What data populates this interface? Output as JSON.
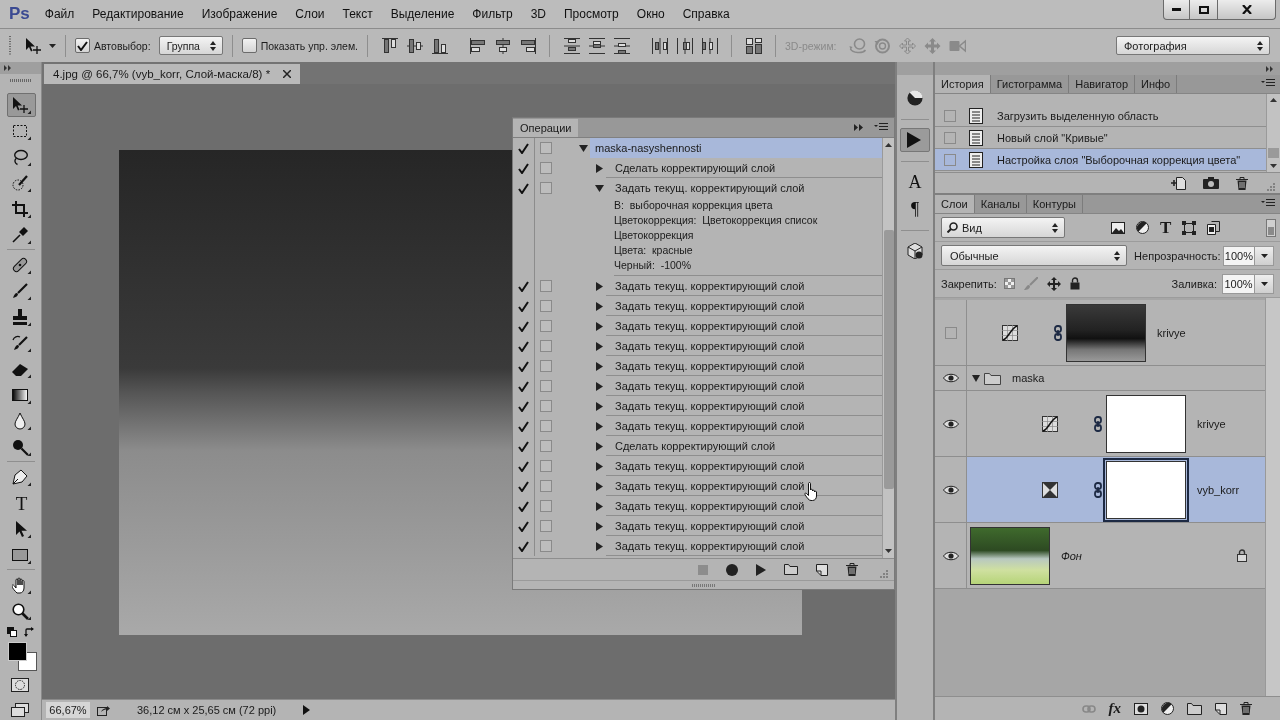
{
  "app": {
    "logo": "Ps"
  },
  "menu": [
    "Файл",
    "Редактирование",
    "Изображение",
    "Слои",
    "Текст",
    "Выделение",
    "Фильтр",
    "3D",
    "Просмотр",
    "Окно",
    "Справка"
  ],
  "options_bar": {
    "auto_select": {
      "label": "Автовыбор:",
      "checked": true
    },
    "auto_select_target": "Группа",
    "show_transform": {
      "label": "Показать упр. элем.",
      "checked": false
    },
    "mode_3d": {
      "label": "3D-режим:",
      "disabled": true
    },
    "workspace": "Фотография"
  },
  "tool_groups": [
    [
      {
        "kind": "move",
        "selected": true
      },
      {
        "kind": "marquee",
        "selected": false
      },
      {
        "kind": "lasso",
        "selected": false
      },
      {
        "kind": "quickselect",
        "selected": false
      },
      {
        "kind": "crop",
        "selected": false
      },
      {
        "kind": "eyedropper",
        "selected": false
      }
    ],
    [
      {
        "kind": "healing",
        "selected": false
      },
      {
        "kind": "brush",
        "selected": false
      },
      {
        "kind": "stamp",
        "selected": false
      },
      {
        "kind": "historybrush",
        "selected": false
      },
      {
        "kind": "eraser",
        "selected": false
      },
      {
        "kind": "gradient",
        "selected": false
      },
      {
        "kind": "blur",
        "selected": false
      },
      {
        "kind": "dodge",
        "selected": false
      }
    ],
    [
      {
        "kind": "pen",
        "selected": false
      },
      {
        "kind": "type",
        "glyph": "T",
        "selected": false
      },
      {
        "kind": "pathselect",
        "selected": false
      },
      {
        "kind": "shape",
        "selected": false
      }
    ],
    [
      {
        "kind": "hand",
        "selected": false
      },
      {
        "kind": "zoom",
        "selected": false
      }
    ]
  ],
  "document": {
    "tab_title": "4.jpg @ 66,7% (vyb_korr, Слой-маска/8) *",
    "zoom": "66,67%",
    "doc_info": "36,12 см x 25,65 см (72 ppi)"
  },
  "actions_panel": {
    "title": "Операции",
    "items": [
      {
        "label": "maska-nasyshennosti",
        "checked": true,
        "dialog": false,
        "expanded": true,
        "selected": true,
        "children": [
          {
            "label": "Сделать корректирующий слой",
            "checked": true,
            "dialog": false,
            "expanded": false,
            "selected": false
          },
          {
            "label": "Задать текущ. корректирующий слой",
            "checked": true,
            "dialog": false,
            "expanded": true,
            "selected": false,
            "details": [
              "В:  выборочная коррекция цвета",
              "Цветокоррекция:  Цветокоррекция список",
              "Цветокоррекция",
              "Цвета:  красные",
              "Черный:  -100%"
            ]
          },
          {
            "label": "Задать текущ. корректирующий слой",
            "checked": true,
            "dialog": false,
            "expanded": false,
            "selected": false
          },
          {
            "label": "Задать текущ. корректирующий слой",
            "checked": true,
            "dialog": false,
            "expanded": false,
            "selected": false
          },
          {
            "label": "Задать текущ. корректирующий слой",
            "checked": true,
            "dialog": false,
            "expanded": false,
            "selected": false
          },
          {
            "label": "Задать текущ. корректирующий слой",
            "checked": true,
            "dialog": false,
            "expanded": false,
            "selected": false
          },
          {
            "label": "Задать текущ. корректирующий слой",
            "checked": true,
            "dialog": false,
            "expanded": false,
            "selected": false
          },
          {
            "label": "Задать текущ. корректирующий слой",
            "checked": true,
            "dialog": false,
            "expanded": false,
            "selected": false
          },
          {
            "label": "Задать текущ. корректирующий слой",
            "checked": true,
            "dialog": false,
            "expanded": false,
            "selected": false
          },
          {
            "label": "Задать текущ. корректирующий слой",
            "checked": true,
            "dialog": false,
            "expanded": false,
            "selected": false
          },
          {
            "label": "Сделать корректирующий слой",
            "checked": true,
            "dialog": false,
            "expanded": false,
            "selected": false
          },
          {
            "label": "Задать текущ. корректирующий слой",
            "checked": true,
            "dialog": false,
            "expanded": false,
            "selected": false
          },
          {
            "label": "Задать текущ. корректирующий слой",
            "checked": true,
            "dialog": false,
            "expanded": false,
            "selected": false
          },
          {
            "label": "Задать текущ. корректирующий слой",
            "checked": true,
            "dialog": false,
            "expanded": false,
            "selected": false
          },
          {
            "label": "Задать текущ. корректирующий слой",
            "checked": true,
            "dialog": false,
            "expanded": false,
            "selected": false
          },
          {
            "label": "Задать текущ. корректирующий слой",
            "checked": true,
            "dialog": false,
            "expanded": false,
            "selected": false
          }
        ]
      }
    ]
  },
  "side_strip": [
    [
      {
        "kind": "adjust",
        "selected": false
      }
    ],
    [
      {
        "kind": "actions",
        "selected": true
      }
    ],
    [
      {
        "kind": "character",
        "glyph": "A",
        "selected": false
      },
      {
        "kind": "paragraph",
        "glyph": "¶",
        "selected": false
      }
    ],
    [
      {
        "kind": "scene",
        "selected": false
      }
    ]
  ],
  "history_panel": {
    "tabs": [
      {
        "label": "История",
        "selected": true
      },
      {
        "label": "Гистограмма",
        "selected": false
      },
      {
        "label": "Навигатор",
        "selected": false
      },
      {
        "label": "Инфо",
        "selected": false
      }
    ],
    "items": [
      {
        "label": "Загрузить выделенную область",
        "source": false,
        "selected": false
      },
      {
        "label": "Новый слой \"Кривые\"",
        "source": false,
        "selected": false
      },
      {
        "label": "Настройка слоя \"Выборочная коррекция цвета\"",
        "source": false,
        "selected": true
      }
    ]
  },
  "layers_panel": {
    "tabs": [
      {
        "label": "Слои",
        "selected": true
      },
      {
        "label": "Каналы",
        "selected": false
      },
      {
        "label": "Контуры",
        "selected": false
      }
    ],
    "filter": "Вид",
    "filter_type_glyph": "T",
    "filter_on": false,
    "blend_mode": "Обычные",
    "opacity_label": "Непрозрачность:",
    "opacity": "100%",
    "lock_label": "Закрепить:",
    "fill_label": "Заливка:",
    "fill": "100%",
    "fx_label": "fx",
    "layers": [
      {
        "name": "krivye",
        "kind": "curves",
        "visible": false,
        "selected": false,
        "locked": false,
        "mask_blank": false
      },
      {
        "name": "maska",
        "kind": "group",
        "visible": true,
        "selected": false,
        "locked": false,
        "expanded": true,
        "children": [
          {
            "name": "krivye",
            "kind": "curves",
            "visible": true,
            "selected": false,
            "locked": false,
            "mask_blank": true
          },
          {
            "name": "vyb_korr",
            "kind": "selective",
            "visible": true,
            "selected": true,
            "locked": false,
            "mask_blank": true
          }
        ]
      },
      {
        "name": "Фон",
        "kind": "photo",
        "visible": true,
        "selected": false,
        "locked": true
      }
    ]
  }
}
